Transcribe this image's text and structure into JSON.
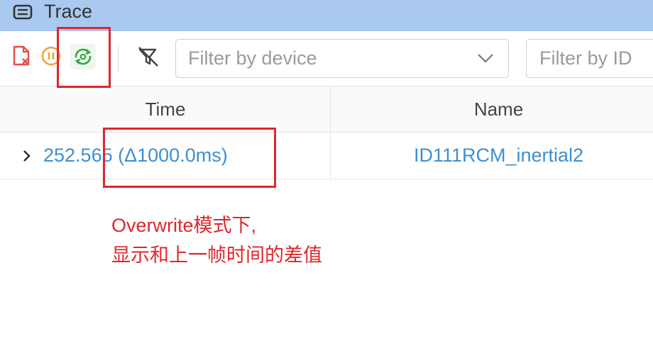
{
  "window": {
    "title": "Trace",
    "icon": "list-panel-icon"
  },
  "toolbar": {
    "buttons": [
      {
        "name": "clear-trace",
        "icon": "file-clear-icon",
        "color": "#e34c4c"
      },
      {
        "name": "pause-trace",
        "icon": "pause-circle-icon",
        "color": "#f0a33a"
      },
      {
        "name": "overwrite-mode",
        "icon": "overwrite-cycle-icon",
        "color": "#2faa3e"
      },
      {
        "name": "clear-filter",
        "icon": "filter-clear-icon",
        "color": "#444444"
      }
    ],
    "device_filter": {
      "placeholder": "Filter by device"
    },
    "id_filter": {
      "placeholder": "Filter by ID"
    }
  },
  "table": {
    "columns": [
      "Time",
      "Name"
    ],
    "rows": [
      {
        "time": "252.565 (Δ1000.0ms)",
        "name": "ID111RCM_inertial2"
      }
    ]
  },
  "annotation": {
    "line1": "Overwrite模式下,",
    "line2": "显示和上一帧时间的差值",
    "color": "#e0262b"
  }
}
